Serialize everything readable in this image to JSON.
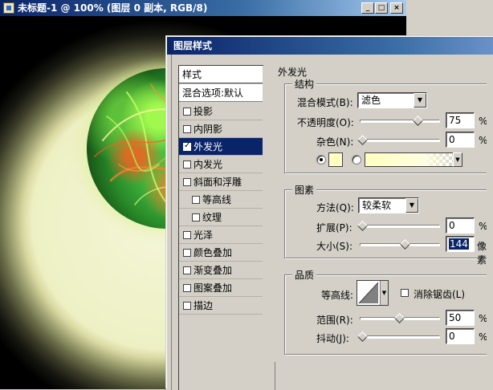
{
  "doc_window": {
    "title": "未标题-1 @ 100% (图层 0 副本, RGB/8)",
    "buttons": [
      "_",
      "□",
      "×"
    ]
  },
  "dialog": {
    "title": "图层样式",
    "styles_header": "样式",
    "blend_options": "混合选项:默认",
    "styles": [
      {
        "label": "投影",
        "checked": false
      },
      {
        "label": "内阴影",
        "checked": false
      },
      {
        "label": "外发光",
        "checked": true,
        "selected": true
      },
      {
        "label": "内发光",
        "checked": false
      },
      {
        "label": "斜面和浮雕",
        "checked": false
      },
      {
        "label": "等高线",
        "checked": false,
        "sub": true
      },
      {
        "label": "纹理",
        "checked": false,
        "sub": true
      },
      {
        "label": "光泽",
        "checked": false
      },
      {
        "label": "颜色叠加",
        "checked": false
      },
      {
        "label": "渐变叠加",
        "checked": false
      },
      {
        "label": "图案叠加",
        "checked": false
      },
      {
        "label": "描边",
        "checked": false
      }
    ],
    "panel_title": "外发光",
    "structure": {
      "title": "结构",
      "blend_mode_label": "混合模式(B):",
      "blend_mode_value": "滤色",
      "opacity_label": "不透明度(O):",
      "opacity_value": "75",
      "opacity_fraction": 0.75,
      "noise_label": "杂色(N):",
      "noise_value": "0",
      "noise_fraction": 0,
      "unit": "%",
      "color_swatch": "#ffffc0"
    },
    "elements": {
      "title": "图素",
      "method_label": "方法(Q):",
      "method_value": "较柔软",
      "spread_label": "扩展(P):",
      "spread_value": "0",
      "spread_fraction": 0,
      "size_label": "大小(S):",
      "size_value": "144",
      "size_fraction": 0.58,
      "size_unit": "像素",
      "unit": "%"
    },
    "quality": {
      "title": "品质",
      "contour_label": "等高线:",
      "antialias_label": "消除锯齿(L)",
      "range_label": "范围(R):",
      "range_value": "50",
      "range_fraction": 0.5,
      "jitter_label": "抖动(J):",
      "jitter_value": "0",
      "jitter_fraction": 0,
      "unit": "%"
    }
  }
}
